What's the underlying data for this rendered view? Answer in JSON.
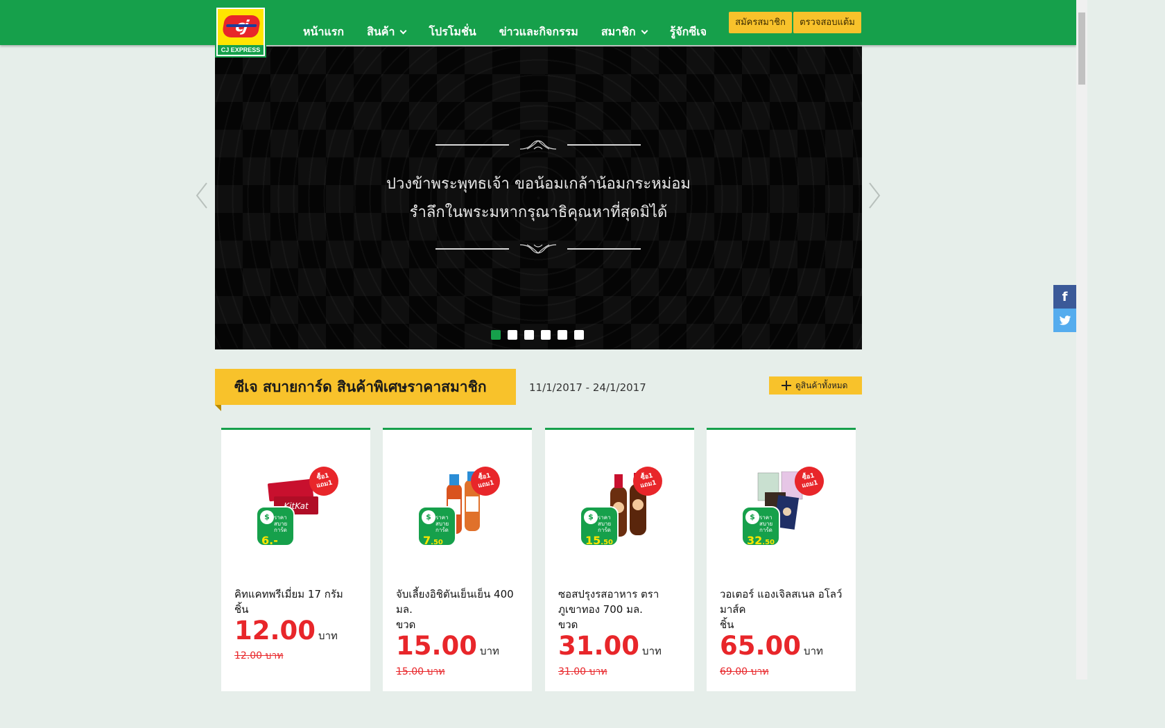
{
  "header": {
    "logo_text": "CJ EXPRESS",
    "logo_mark": "cj",
    "nav": [
      {
        "label": "หน้าแรก",
        "dropdown": false
      },
      {
        "label": "สินค้า",
        "dropdown": true
      },
      {
        "label": "โปรโมชั่น",
        "dropdown": false
      },
      {
        "label": "ข่าวและกิจกรรม",
        "dropdown": false
      },
      {
        "label": "สมาชิก",
        "dropdown": true
      },
      {
        "label": "รู้จักซีเจ",
        "dropdown": false
      }
    ],
    "register_label": "สมัครสมาชิก",
    "check_points_label": "ตรวจสอบแต้ม"
  },
  "hero": {
    "line1": "ปวงข้าพระพุทธเจ้า ขอน้อมเกล้าน้อมกระหม่อม",
    "line2": "รำลึกในพระมหากรุณาธิคุณหาที่สุดมิได้",
    "slide_count": 6,
    "active_slide": 1
  },
  "section": {
    "title": "ซีเจ สบายการ์ด สินค้าพิเศษราคาสมาชิก",
    "date_range": "11/1/2017 - 24/1/2017",
    "view_all": "ดูสินค้าทั้งหมด"
  },
  "products": [
    {
      "name": "คิทแคทพรีเมี่ยม 17 กรัม",
      "unit": "ชิ้น",
      "price": "12.00",
      "currency": "บาท",
      "old_price": "12.00 บาท",
      "burst": "ซื้อ1 แถม1",
      "badge_label": "ราคา สบายการ์ด",
      "badge_price": "6.-",
      "badge_price_sub": "",
      "color": "#c8102e"
    },
    {
      "name": "จับเลี้ยงอิชิตันเย็นเย็น 400 มล.",
      "unit": "ขวด",
      "price": "15.00",
      "currency": "บาท",
      "old_price": "15.00 บาท",
      "burst": "ซื้อ1 แถม1",
      "badge_label": "ราคา สบายการ์ด",
      "badge_price": "7",
      "badge_price_sub": ".50",
      "color": "#d9531e"
    },
    {
      "name": "ซอสปรุงรสอาหาร ตรา ภูเขาทอง 700 มล.",
      "unit": "ขวด",
      "price": "31.00",
      "currency": "บาท",
      "old_price": "31.00 บาท",
      "burst": "ซื้อ1 แถม1",
      "badge_label": "ราคา สบายการ์ด",
      "badge_price": "15",
      "badge_price_sub": ".50",
      "color": "#6b2e0f"
    },
    {
      "name": "วอเตอร์ แองเจิลสเนล อโลว์ มาส์ค",
      "unit": "ชิ้น",
      "price": "65.00",
      "currency": "บาท",
      "old_price": "69.00 บาท",
      "burst": "ซื้อ1 แถม1",
      "badge_label": "ราคา สบายการ์ด",
      "badge_price": "32",
      "badge_price_sub": ".50",
      "color": "#2b3d7a"
    }
  ],
  "social": {
    "facebook": "f",
    "twitter": "t"
  },
  "icons": [
    "chevron-down-icon",
    "chevron-left-icon",
    "chevron-right-icon",
    "plus-icon",
    "facebook-icon",
    "twitter-icon"
  ]
}
